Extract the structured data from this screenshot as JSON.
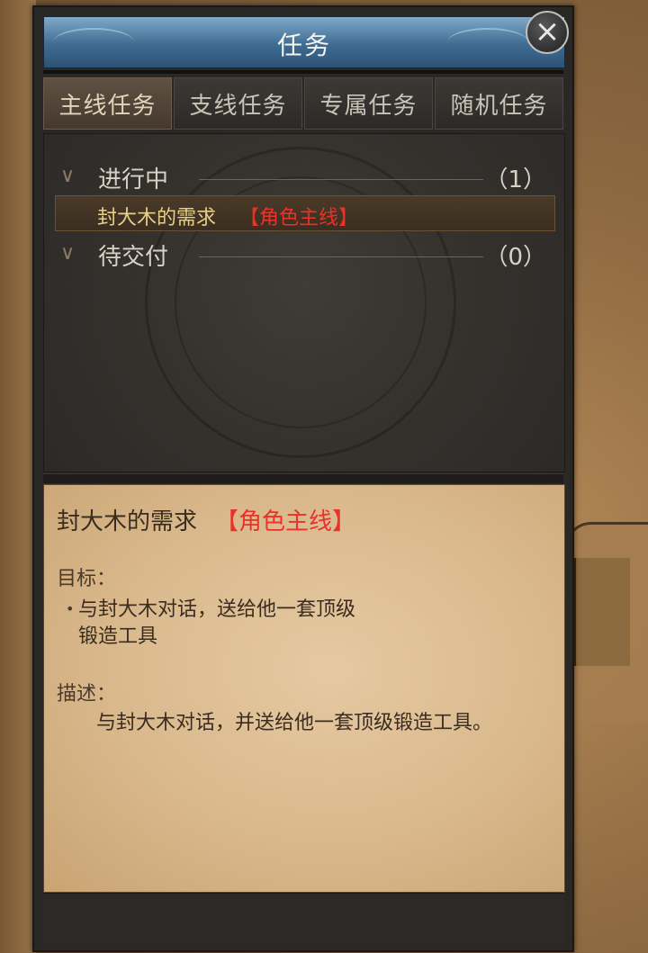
{
  "window": {
    "title": "任务",
    "close_icon": "×"
  },
  "tabs": [
    {
      "label": "主线任务",
      "active": true
    },
    {
      "label": "支线任务",
      "active": false
    },
    {
      "label": "专属任务",
      "active": false
    },
    {
      "label": "随机任务",
      "active": false
    }
  ],
  "groups": [
    {
      "label": "进行中",
      "count": "（1）",
      "icon": "chevron-down-icon"
    },
    {
      "label": "待交付",
      "count": "（0）",
      "icon": "chevron-down-icon"
    }
  ],
  "quest": {
    "name": "封大木的需求",
    "tag": "【角色主线】"
  },
  "detail": {
    "title": "封大木的需求",
    "tag": "【角色主线】",
    "objective_label": "目标：",
    "objective_line1": "与封大木对话，送给他一套顶级",
    "objective_line2": "锻造工具",
    "description_label": "描述：",
    "description_text": "与封大木对话，并送给他一套顶级锻造工具。"
  },
  "colors": {
    "tag_red": "#e8322a",
    "quest_gold": "#e6d08a",
    "title_blue": "#3f6c92"
  }
}
